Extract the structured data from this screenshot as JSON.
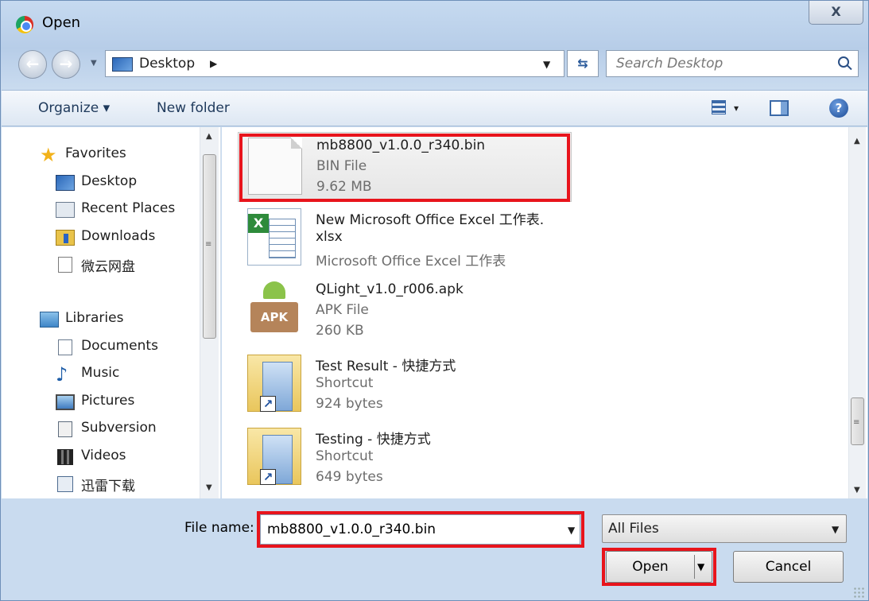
{
  "window": {
    "title": "Open",
    "close_label": "X"
  },
  "address": {
    "location": "Desktop",
    "search_placeholder": "Search Desktop"
  },
  "toolbar": {
    "organize_label": "Organize ▾",
    "new_folder_label": "New folder",
    "views_drop": "▾"
  },
  "nav": {
    "favorites": [
      {
        "label": "Favorites"
      },
      {
        "label": "Desktop"
      },
      {
        "label": "Recent Places"
      },
      {
        "label": "Downloads"
      },
      {
        "label": "微云网盘"
      }
    ],
    "libraries": [
      {
        "label": "Libraries"
      },
      {
        "label": "Documents"
      },
      {
        "label": "Music"
      },
      {
        "label": "Pictures"
      },
      {
        "label": "Subversion"
      },
      {
        "label": "Videos"
      },
      {
        "label": "迅雷下载"
      }
    ]
  },
  "files": [
    {
      "name": "mb8800_v1.0.0_r340.bin",
      "type": "BIN File",
      "size": "9.62 MB",
      "icon": "blank-file-icon",
      "selected": true
    },
    {
      "name": "New Microsoft Office Excel 工作表.",
      "name2": "xlsx",
      "type": "Microsoft Office Excel 工作表",
      "icon": "excel-file-icon"
    },
    {
      "name": "QLight_v1.0_r006.apk",
      "type": "APK File",
      "size": "260 KB",
      "icon": "android-apk-icon"
    },
    {
      "name": "Test Result - 快捷方式",
      "type": "Shortcut",
      "size": "924 bytes",
      "icon": "folder-shortcut-icon"
    },
    {
      "name": "Testing - 快捷方式",
      "type": "Shortcut",
      "size": "649 bytes",
      "icon": "folder-shortcut-icon"
    }
  ],
  "bottom": {
    "file_name_label": "File name:",
    "file_name_value": "mb8800_v1.0.0_r340.bin",
    "filter_value": "All Files",
    "open_label": "Open",
    "cancel_label": "Cancel"
  },
  "colors": {
    "highlight_border": "#e8141c",
    "title_gradient": "#c6daf0",
    "toolbar_text": "#1e395b"
  }
}
